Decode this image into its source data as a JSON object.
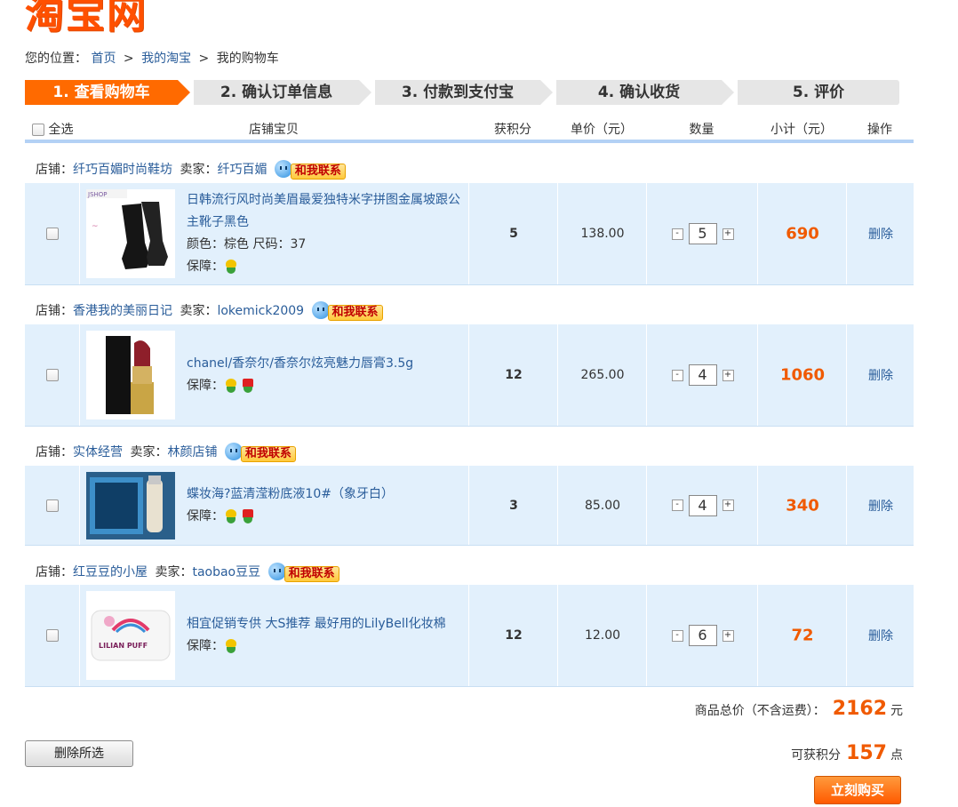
{
  "logo": "淘宝网",
  "breadcrumb": {
    "prefix": "您的位置：",
    "home": "首页",
    "sep": ">",
    "my": "我的淘宝",
    "current": "我的购物车"
  },
  "steps": [
    "1. 查看购物车",
    "2. 确认订单信息",
    "3. 付款到支付宝",
    "4. 确认收货",
    "5. 评价"
  ],
  "table_header": {
    "select_all": "全选",
    "item": "店铺宝贝",
    "points": "获积分",
    "price": "单价（元）",
    "qty": "数量",
    "subtotal": "小计（元）",
    "ops": "操作"
  },
  "labels": {
    "shop": "店铺：",
    "seller": "卖家：",
    "contact": "和我联系",
    "guarantee": "保障：",
    "delete": "删除",
    "qty_minus": "-",
    "qty_plus": "+"
  },
  "items": [
    {
      "shop": "纤巧百媚时尚鞋坊",
      "seller": "纤巧百媚",
      "title": "日韩流行风时尚美眉最爱独特米字拼图金属坡跟公主靴子黑色",
      "meta": "颜色：棕色 尺码：37",
      "points": "5",
      "price": "138.00",
      "qty": "5",
      "subtotal": "690",
      "thumb_text": "JSHOP"
    },
    {
      "shop": "香港我的美丽日记",
      "seller": "lokemick2009",
      "title": "chanel/香奈尔/香奈尔炫亮魅力唇膏3.5g",
      "meta": "",
      "points": "12",
      "price": "265.00",
      "qty": "4",
      "subtotal": "1060",
      "thumb_text": ""
    },
    {
      "shop": "实体经营",
      "seller": "林颜店铺",
      "title": "蝶妆海?蓝清滢粉底液10#（象牙白）",
      "meta": "",
      "points": "3",
      "price": "85.00",
      "qty": "4",
      "subtotal": "340",
      "thumb_text": ""
    },
    {
      "shop": "红豆豆的小屋",
      "seller": "taobao豆豆",
      "title": "相宜促销专供 大S推荐 最好用的LilyBell化妆棉",
      "meta": "",
      "points": "12",
      "price": "12.00",
      "qty": "6",
      "subtotal": "72",
      "thumb_text": "LILIAN PUFF"
    }
  ],
  "footer": {
    "total_label": "商品总价（不含运费）：",
    "total_value": "2162",
    "total_unit": "元",
    "points_label": "可获积分",
    "points_value": "157",
    "points_unit": "点",
    "delete_selected": "删除所选",
    "buy_now": "立刻购买"
  },
  "colors": {
    "accent": "#ff6a00",
    "row_bg": "#e2f0fc",
    "link": "#2a5d9a",
    "price": "#f05a00"
  }
}
